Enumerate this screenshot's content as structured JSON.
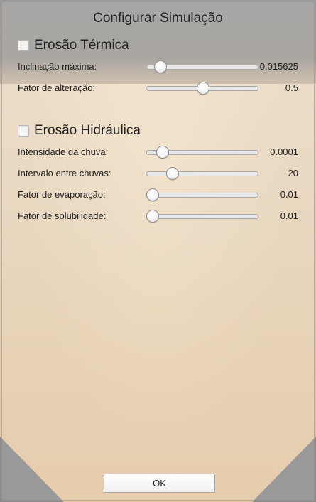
{
  "dialog": {
    "title": "Configurar Simulação"
  },
  "thermal": {
    "label": "Erosão Térmica",
    "checked": false,
    "rows": [
      {
        "label": "Inclinação máxima:",
        "value": "0.015625",
        "fill": 0.12
      },
      {
        "label": "Fator de alteração:",
        "value": "0.5",
        "fill": 0.5
      }
    ]
  },
  "hydraulic": {
    "label": "Erosão Hidráulica",
    "checked": false,
    "rows": [
      {
        "label": "Intensidade da chuva:",
        "value": "0.0001",
        "fill": 0.14
      },
      {
        "label": "Intervalo entre chuvas:",
        "value": "20",
        "fill": 0.23
      },
      {
        "label": "Fator de evaporação:",
        "value": "0.01",
        "fill": 0.05
      },
      {
        "label": "Fator de solubilidade:",
        "value": "0.01",
        "fill": 0.05
      }
    ]
  },
  "footer": {
    "ok_label": "OK"
  }
}
